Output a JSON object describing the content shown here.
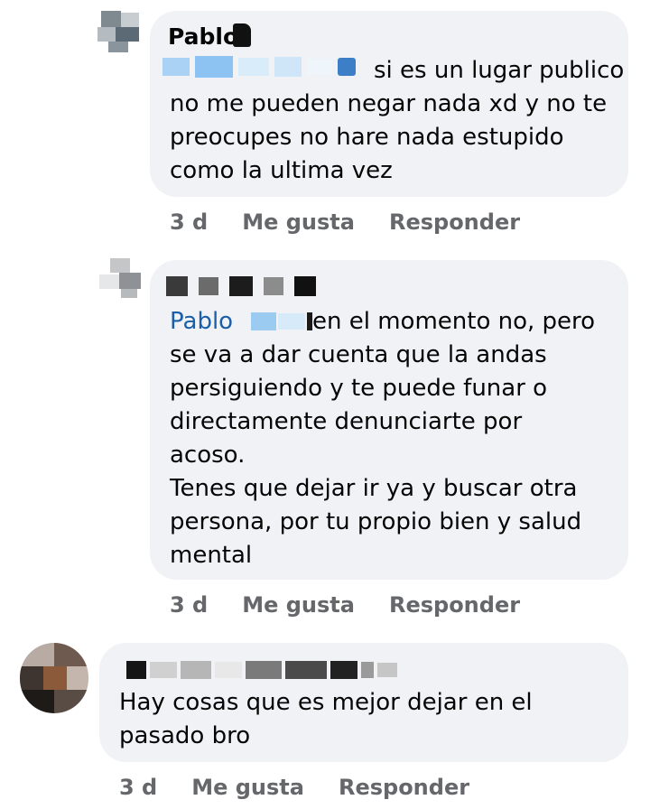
{
  "comments": [
    {
      "author": "Pablo",
      "text": "si es un lugar publico\nno me pueden negar nada xd y no te\npreocupes no hare nada estupido\ncomo la ultima vez",
      "time": "3 d",
      "like": "Me gusta",
      "reply": "Responder"
    },
    {
      "mention": "Pablo",
      "text": "en el momento no, pero\nse va a dar cuenta que la andas\npersiguiendo y te puede funar o\ndirectamente denunciarte por\nacoso.\nTenes que dejar ir ya y buscar otra\npersona, por tu propio bien y salud\nmental",
      "time": "3 d",
      "like": "Me gusta",
      "reply": "Responder"
    },
    {
      "text": "Hay cosas que es mejor dejar en el\npasado bro",
      "time": "3 d",
      "like": "Me gusta",
      "reply": "Responder"
    }
  ],
  "colors": {
    "bubble": "#f0f2f5",
    "mention": "#1a5fa8",
    "meta": "#65676b"
  }
}
